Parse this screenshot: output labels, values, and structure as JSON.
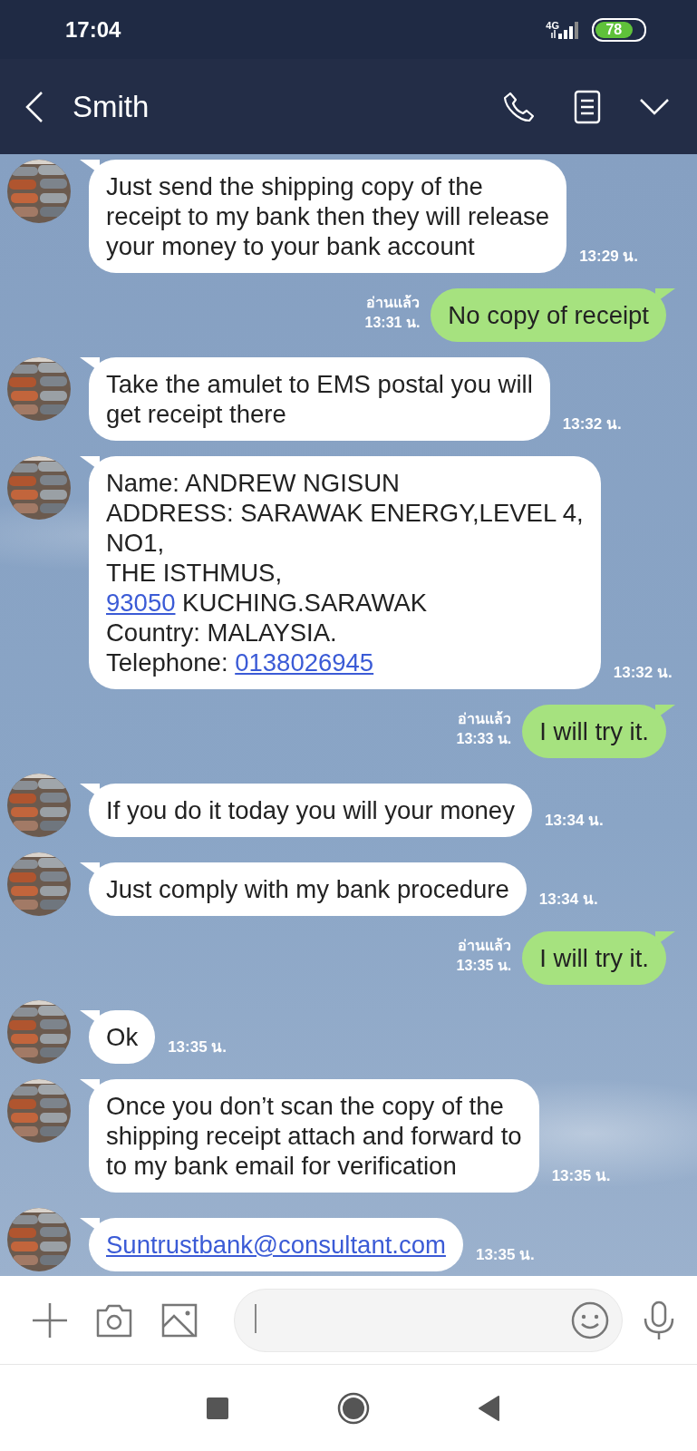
{
  "status_bar": {
    "time": "17:04",
    "network": "4G",
    "battery": "78"
  },
  "header": {
    "title": "Smith"
  },
  "messages": [
    {
      "kind": "in",
      "segments": [
        {
          "text": "Just send the shipping copy of the\nreceipt to my bank then they will release\nyour money to your bank account",
          "link": false
        }
      ],
      "time": "13:29 น."
    },
    {
      "kind": "out",
      "segments": [
        {
          "text": "No copy of receipt",
          "link": false
        }
      ],
      "read": "อ่านแล้ว",
      "time": "13:31 น."
    },
    {
      "kind": "in",
      "segments": [
        {
          "text": "Take the amulet to EMS postal you will\nget receipt there",
          "link": false
        }
      ],
      "time": "13:32 น."
    },
    {
      "kind": "in",
      "segments": [
        {
          "text": "Name: ANDREW NGISUN\nADDRESS: SARAWAK ENERGY,LEVEL 4,\nNO1,\nTHE ISTHMUS,\n",
          "link": false
        },
        {
          "text": "93050",
          "link": true
        },
        {
          "text": " KUCHING.SARAWAK\nCountry: MALAYSIA.\nTelephone: ",
          "link": false
        },
        {
          "text": "0138026945",
          "link": true
        }
      ],
      "time": "13:32 น."
    },
    {
      "kind": "out",
      "segments": [
        {
          "text": "I will try it.",
          "link": false
        }
      ],
      "read": "อ่านแล้ว",
      "time": "13:33 น."
    },
    {
      "kind": "in",
      "segments": [
        {
          "text": "If you do it today you will your money",
          "link": false
        }
      ],
      "time": "13:34 น."
    },
    {
      "kind": "in",
      "segments": [
        {
          "text": "Just comply with my bank procedure",
          "link": false
        }
      ],
      "time": "13:34 น."
    },
    {
      "kind": "out",
      "segments": [
        {
          "text": "I will try it.",
          "link": false
        }
      ],
      "read": "อ่านแล้ว",
      "time": "13:35 น."
    },
    {
      "kind": "in",
      "segments": [
        {
          "text": "Ok",
          "link": false
        }
      ],
      "time": "13:35 น."
    },
    {
      "kind": "in",
      "segments": [
        {
          "text": "Once you don’t scan the copy of the\nshipping receipt attach and forward to\nto my bank email for verification",
          "link": false
        }
      ],
      "time": "13:35 น."
    },
    {
      "kind": "in",
      "segments": [
        {
          "text": "Suntrustbank@consultant.com",
          "link": true
        }
      ],
      "time": "13:35 น."
    }
  ]
}
